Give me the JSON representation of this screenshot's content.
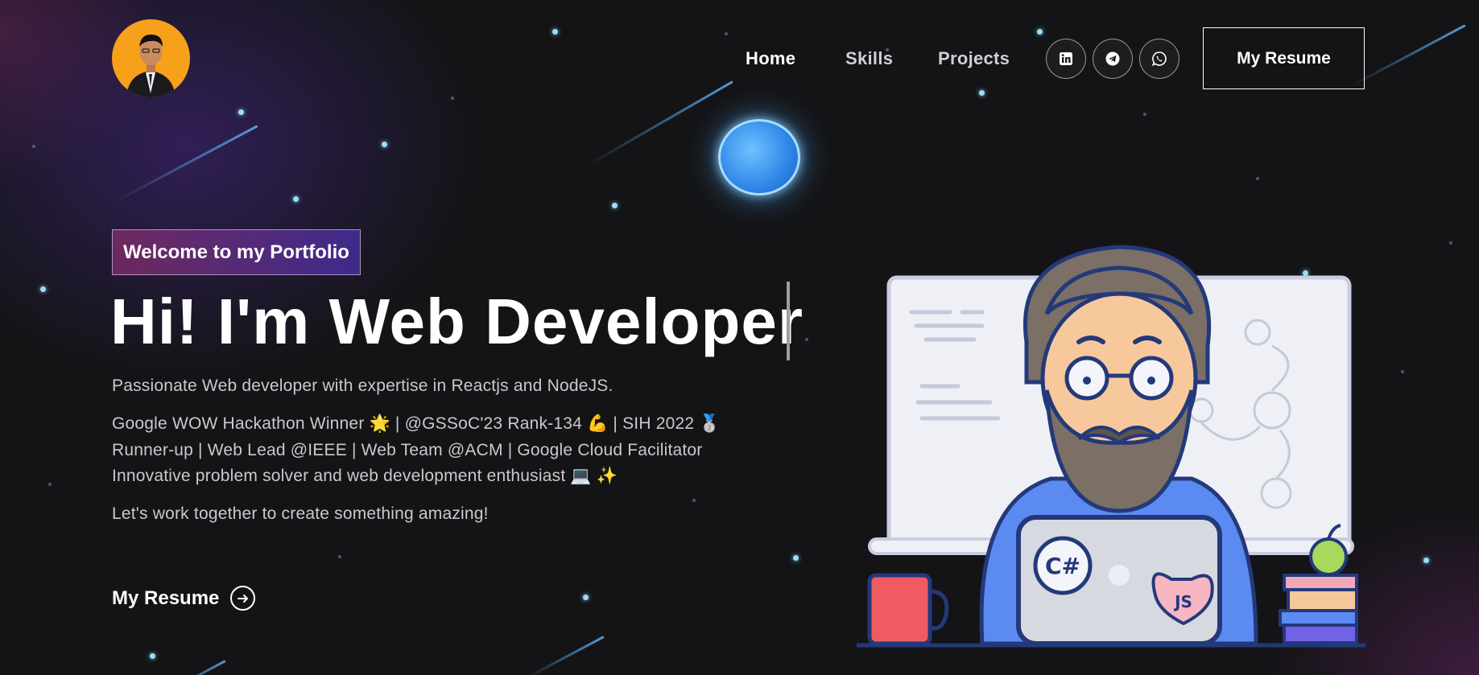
{
  "header": {
    "avatar_alt": "profile photo",
    "nav": [
      {
        "label": "Home",
        "active": true
      },
      {
        "label": "Skills",
        "active": false
      },
      {
        "label": "Projects",
        "active": false
      }
    ],
    "social_icons": [
      "linkedin-icon",
      "telegram-icon",
      "whatsapp-icon"
    ],
    "resume_button": "My Resume"
  },
  "hero": {
    "tagline": "Welcome to my Portfolio",
    "headline": "Hi! I'm Web Developer",
    "intro": "Passionate Web developer with expertise in Reactjs and NodeJS.",
    "achievements_line1": "Google WOW Hackathon Winner 🌟 | @GSSoC'23 Rank-134 💪 | SIH 2022 🥈",
    "achievements_line2": "Runner-up | Web Lead @IEEE | Web Team @ACM | Google Cloud Facilitator",
    "achievements_line3": "Innovative problem solver and web development enthusiast 💻 ✨",
    "cta_text": "Let's work together to create something amazing!",
    "cta_link": "My Resume"
  },
  "colors": {
    "background": "#121214",
    "tagline_gradient_start": "#aa367c",
    "tagline_gradient_end": "#4a2fbd",
    "avatar_bg": "#f7a11a",
    "planet": "#2f86e8"
  }
}
